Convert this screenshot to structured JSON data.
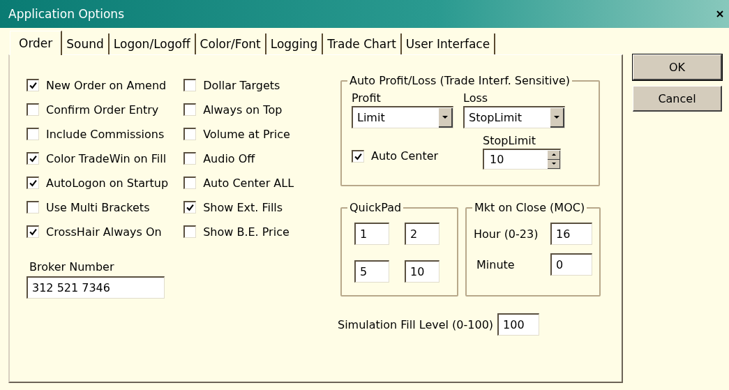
{
  "window": {
    "title": "Application Options"
  },
  "tabs": [
    {
      "label": "Order",
      "selected": true
    },
    {
      "label": "Sound",
      "selected": false
    },
    {
      "label": "Logon/Logoff",
      "selected": false
    },
    {
      "label": "Color/Font",
      "selected": false
    },
    {
      "label": "Logging",
      "selected": false
    },
    {
      "label": "Trade Chart",
      "selected": false
    },
    {
      "label": "User Interface",
      "selected": false
    }
  ],
  "option_columns": [
    [
      {
        "label": "New Order on Amend",
        "checked": true
      },
      {
        "label": "Confirm Order Entry",
        "checked": false
      },
      {
        "label": "Include Commissions",
        "checked": false
      },
      {
        "label": "Color TradeWin on Fill",
        "checked": true
      },
      {
        "label": "AutoLogon on Startup",
        "checked": true
      },
      {
        "label": "Use Multi Brackets",
        "checked": false
      },
      {
        "label": "CrossHair Always On",
        "checked": true
      }
    ],
    [
      {
        "label": "Dollar Targets",
        "checked": false
      },
      {
        "label": "Always on Top",
        "checked": false
      },
      {
        "label": "Volume at Price",
        "checked": false
      },
      {
        "label": "Audio Off",
        "checked": false
      },
      {
        "label": "Auto Center ALL",
        "checked": false
      },
      {
        "label": "Show Ext. Fills",
        "checked": true
      },
      {
        "label": "Show B.E. Price",
        "checked": false
      }
    ]
  ],
  "broker_number": {
    "label": "Broker Number",
    "value": "312 521 7346"
  },
  "auto_profit_loss": {
    "title": "Auto Profit/Loss (Trade Interf. Sensitive)",
    "profit": {
      "label": "Profit",
      "value": "Limit"
    },
    "loss": {
      "label": "Loss",
      "value": "StopLimit"
    },
    "auto_center": {
      "label": "Auto Center",
      "checked": true
    },
    "stop_limit": {
      "label": "StopLimit",
      "value": "10"
    }
  },
  "quickpad": {
    "title": "QuickPad",
    "values": [
      "1",
      "2",
      "5",
      "10"
    ]
  },
  "market_on_close": {
    "title": "Mkt on Close (MOC)",
    "hour": {
      "label": "Hour (0-23)",
      "value": "16"
    },
    "minute": {
      "label": "Minute",
      "value": "0"
    }
  },
  "simulation_fill": {
    "label": "Simulation Fill Level (0-100)",
    "value": "100"
  },
  "buttons": [
    "OK",
    "Cancel"
  ]
}
